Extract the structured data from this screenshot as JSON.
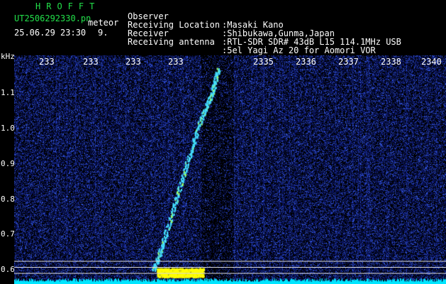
{
  "header": {
    "brand": "HROFFT",
    "filename": "UT2506292330.pn",
    "event_label": "meteor",
    "datetime": "25.06.29 23:30",
    "count": "9."
  },
  "metadata": [
    {
      "label": "Observer",
      "value": ":Masaki Kano"
    },
    {
      "label": "Receiving Location",
      "value": ":Shibukawa,Gunma,Japan"
    },
    {
      "label": "Receiver",
      "value": ":RTL-SDR SDR# 43dB L15 114.1MHz USB"
    },
    {
      "label": "Receiving antenna",
      "value": ":5el Yagi Az 20 for Aomori VOR"
    }
  ],
  "colors": {
    "background": "#000000",
    "noise_dark": "#0a1460",
    "noise_light": "#2f4fd0",
    "echo": "#44e0ff",
    "echo_hot": "#ffff00",
    "baseline": "#00e5ff",
    "header_green": "#22e04a"
  },
  "chart_data": {
    "type": "heatmap",
    "title": "",
    "xlabel": "",
    "ylabel": "kHz",
    "x_ticks": [
      "233",
      "233",
      "233",
      "233",
      "2335",
      "2336",
      "2337",
      "2338",
      "2340"
    ],
    "y_ticks": [
      "1.1",
      "1.0",
      "0.9",
      "0.8",
      "0.7",
      "0.6"
    ],
    "ylim": [
      0.58,
      1.18
    ],
    "xlim_minutes": [
      0,
      10
    ],
    "meteor_trail": [
      {
        "t": 3.28,
        "f": 0.6
      },
      {
        "t": 3.5,
        "f": 0.68
      },
      {
        "t": 3.8,
        "f": 0.8
      },
      {
        "t": 4.1,
        "f": 0.92
      },
      {
        "t": 4.4,
        "f": 1.03
      },
      {
        "t": 4.65,
        "f": 1.1
      },
      {
        "t": 4.8,
        "f": 1.17
      }
    ],
    "hot_band": {
      "t_start": 3.35,
      "t_end": 4.45,
      "f_min": 0.58,
      "f_max": 0.605
    },
    "reference_lines_khz": [
      0.624,
      0.607,
      0.59
    ]
  }
}
